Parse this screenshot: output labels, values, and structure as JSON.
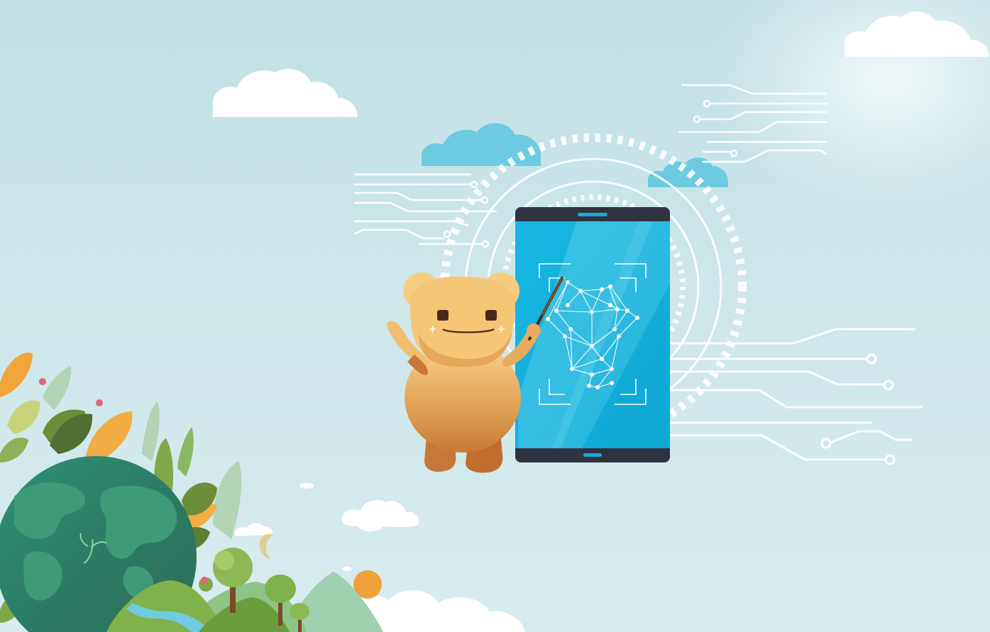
{
  "colors": {
    "sky_top": "#bfe0e4",
    "sky_bottom": "#d7ecee",
    "cloud_white": "#ffffff",
    "cloud_blue": "#6ccbe0",
    "circuit_line": "#ffffff",
    "phone_frame": "#2f3340",
    "phone_screen": "#15b1dc",
    "phone_button": "#1aa9d6",
    "mascot_light": "#f6c779",
    "mascot_dark": "#c7742d",
    "globe_ocean": "#2f7f66",
    "globe_land": "#3f9a78",
    "leaf_orange": "#f0a63a",
    "leaf_green": "#7fa84a",
    "sun": "#f0a03a"
  },
  "illustration": {
    "subject": "mascot-with-pointer-and-face-scan-phone",
    "icons": [
      "cloud-icon",
      "circuit-lines-icon",
      "face-scan-icon",
      "globe-icon",
      "tree-icon",
      "sun-icon"
    ]
  }
}
